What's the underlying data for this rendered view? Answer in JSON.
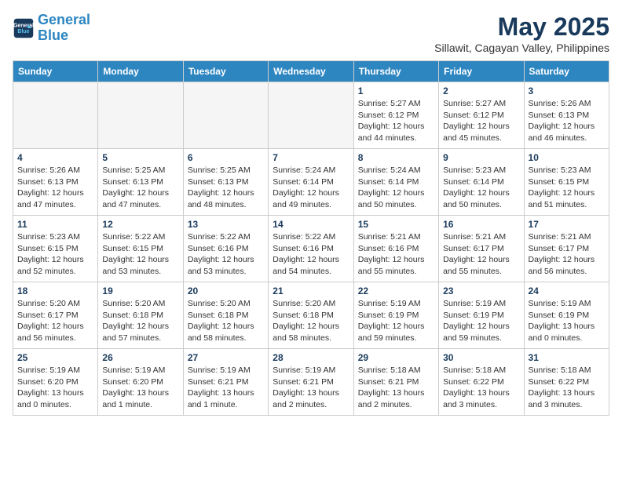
{
  "header": {
    "logo_line1": "General",
    "logo_line2": "Blue",
    "month": "May 2025",
    "location": "Sillawit, Cagayan Valley, Philippines"
  },
  "days_of_week": [
    "Sunday",
    "Monday",
    "Tuesday",
    "Wednesday",
    "Thursday",
    "Friday",
    "Saturday"
  ],
  "weeks": [
    [
      {
        "day": "",
        "info": ""
      },
      {
        "day": "",
        "info": ""
      },
      {
        "day": "",
        "info": ""
      },
      {
        "day": "",
        "info": ""
      },
      {
        "day": "1",
        "info": "Sunrise: 5:27 AM\nSunset: 6:12 PM\nDaylight: 12 hours\nand 44 minutes."
      },
      {
        "day": "2",
        "info": "Sunrise: 5:27 AM\nSunset: 6:12 PM\nDaylight: 12 hours\nand 45 minutes."
      },
      {
        "day": "3",
        "info": "Sunrise: 5:26 AM\nSunset: 6:13 PM\nDaylight: 12 hours\nand 46 minutes."
      }
    ],
    [
      {
        "day": "4",
        "info": "Sunrise: 5:26 AM\nSunset: 6:13 PM\nDaylight: 12 hours\nand 47 minutes."
      },
      {
        "day": "5",
        "info": "Sunrise: 5:25 AM\nSunset: 6:13 PM\nDaylight: 12 hours\nand 47 minutes."
      },
      {
        "day": "6",
        "info": "Sunrise: 5:25 AM\nSunset: 6:13 PM\nDaylight: 12 hours\nand 48 minutes."
      },
      {
        "day": "7",
        "info": "Sunrise: 5:24 AM\nSunset: 6:14 PM\nDaylight: 12 hours\nand 49 minutes."
      },
      {
        "day": "8",
        "info": "Sunrise: 5:24 AM\nSunset: 6:14 PM\nDaylight: 12 hours\nand 50 minutes."
      },
      {
        "day": "9",
        "info": "Sunrise: 5:23 AM\nSunset: 6:14 PM\nDaylight: 12 hours\nand 50 minutes."
      },
      {
        "day": "10",
        "info": "Sunrise: 5:23 AM\nSunset: 6:15 PM\nDaylight: 12 hours\nand 51 minutes."
      }
    ],
    [
      {
        "day": "11",
        "info": "Sunrise: 5:23 AM\nSunset: 6:15 PM\nDaylight: 12 hours\nand 52 minutes."
      },
      {
        "day": "12",
        "info": "Sunrise: 5:22 AM\nSunset: 6:15 PM\nDaylight: 12 hours\nand 53 minutes."
      },
      {
        "day": "13",
        "info": "Sunrise: 5:22 AM\nSunset: 6:16 PM\nDaylight: 12 hours\nand 53 minutes."
      },
      {
        "day": "14",
        "info": "Sunrise: 5:22 AM\nSunset: 6:16 PM\nDaylight: 12 hours\nand 54 minutes."
      },
      {
        "day": "15",
        "info": "Sunrise: 5:21 AM\nSunset: 6:16 PM\nDaylight: 12 hours\nand 55 minutes."
      },
      {
        "day": "16",
        "info": "Sunrise: 5:21 AM\nSunset: 6:17 PM\nDaylight: 12 hours\nand 55 minutes."
      },
      {
        "day": "17",
        "info": "Sunrise: 5:21 AM\nSunset: 6:17 PM\nDaylight: 12 hours\nand 56 minutes."
      }
    ],
    [
      {
        "day": "18",
        "info": "Sunrise: 5:20 AM\nSunset: 6:17 PM\nDaylight: 12 hours\nand 56 minutes."
      },
      {
        "day": "19",
        "info": "Sunrise: 5:20 AM\nSunset: 6:18 PM\nDaylight: 12 hours\nand 57 minutes."
      },
      {
        "day": "20",
        "info": "Sunrise: 5:20 AM\nSunset: 6:18 PM\nDaylight: 12 hours\nand 58 minutes."
      },
      {
        "day": "21",
        "info": "Sunrise: 5:20 AM\nSunset: 6:18 PM\nDaylight: 12 hours\nand 58 minutes."
      },
      {
        "day": "22",
        "info": "Sunrise: 5:19 AM\nSunset: 6:19 PM\nDaylight: 12 hours\nand 59 minutes."
      },
      {
        "day": "23",
        "info": "Sunrise: 5:19 AM\nSunset: 6:19 PM\nDaylight: 12 hours\nand 59 minutes."
      },
      {
        "day": "24",
        "info": "Sunrise: 5:19 AM\nSunset: 6:19 PM\nDaylight: 13 hours\nand 0 minutes."
      }
    ],
    [
      {
        "day": "25",
        "info": "Sunrise: 5:19 AM\nSunset: 6:20 PM\nDaylight: 13 hours\nand 0 minutes."
      },
      {
        "day": "26",
        "info": "Sunrise: 5:19 AM\nSunset: 6:20 PM\nDaylight: 13 hours\nand 1 minute."
      },
      {
        "day": "27",
        "info": "Sunrise: 5:19 AM\nSunset: 6:21 PM\nDaylight: 13 hours\nand 1 minute."
      },
      {
        "day": "28",
        "info": "Sunrise: 5:19 AM\nSunset: 6:21 PM\nDaylight: 13 hours\nand 2 minutes."
      },
      {
        "day": "29",
        "info": "Sunrise: 5:18 AM\nSunset: 6:21 PM\nDaylight: 13 hours\nand 2 minutes."
      },
      {
        "day": "30",
        "info": "Sunrise: 5:18 AM\nSunset: 6:22 PM\nDaylight: 13 hours\nand 3 minutes."
      },
      {
        "day": "31",
        "info": "Sunrise: 5:18 AM\nSunset: 6:22 PM\nDaylight: 13 hours\nand 3 minutes."
      }
    ]
  ]
}
